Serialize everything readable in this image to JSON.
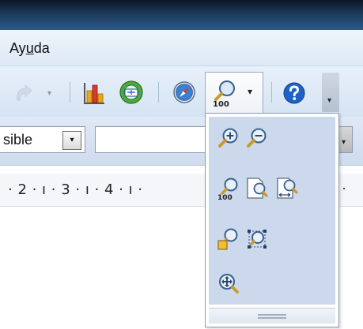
{
  "menubar": {
    "item_label_pre": "Ay",
    "item_label_ul": "u",
    "item_label_post": "da"
  },
  "toolbar": {
    "icons": [
      "redo-icon",
      "chart-icon",
      "navigator-icon",
      "compass-icon",
      "zoom-icon",
      "help-icon"
    ],
    "zoom_label": "100",
    "redo_drop": "▾",
    "zoom_drop": "▾",
    "overflow": "▾"
  },
  "formatbar": {
    "style_value": "sible",
    "style_drop": "▾",
    "font_drop": "▾"
  },
  "ruler": {
    "text": "· 2 · ı · 3 · ı · 4 · ı ·",
    "right_mark": "·"
  },
  "zoom_popup": {
    "icons": [
      "zoom-in-icon",
      "zoom-out-icon",
      "zoom-100-icon",
      "zoom-whole-page-icon",
      "zoom-page-width-icon",
      "zoom-optimal-icon",
      "zoom-object-icon",
      "zoom-shift-icon"
    ],
    "zoom_100_label": "100"
  },
  "colors": {
    "titlebar": "#1c3a5c",
    "toolbar_bg": "#dde9f6",
    "popup_bg": "#ccd9ec",
    "help_blue": "#1e62c8"
  }
}
